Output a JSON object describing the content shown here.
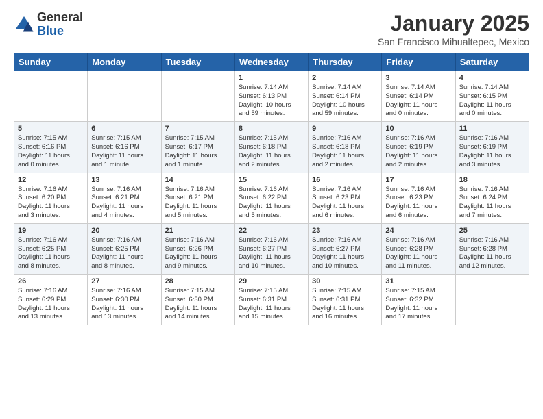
{
  "logo": {
    "general": "General",
    "blue": "Blue"
  },
  "title": "January 2025",
  "subtitle": "San Francisco Mihualtepec, Mexico",
  "days_of_week": [
    "Sunday",
    "Monday",
    "Tuesday",
    "Wednesday",
    "Thursday",
    "Friday",
    "Saturday"
  ],
  "weeks": [
    [
      {
        "num": "",
        "info": ""
      },
      {
        "num": "",
        "info": ""
      },
      {
        "num": "",
        "info": ""
      },
      {
        "num": "1",
        "info": "Sunrise: 7:14 AM\nSunset: 6:13 PM\nDaylight: 10 hours\nand 59 minutes."
      },
      {
        "num": "2",
        "info": "Sunrise: 7:14 AM\nSunset: 6:14 PM\nDaylight: 10 hours\nand 59 minutes."
      },
      {
        "num": "3",
        "info": "Sunrise: 7:14 AM\nSunset: 6:14 PM\nDaylight: 11 hours\nand 0 minutes."
      },
      {
        "num": "4",
        "info": "Sunrise: 7:14 AM\nSunset: 6:15 PM\nDaylight: 11 hours\nand 0 minutes."
      }
    ],
    [
      {
        "num": "5",
        "info": "Sunrise: 7:15 AM\nSunset: 6:16 PM\nDaylight: 11 hours\nand 0 minutes."
      },
      {
        "num": "6",
        "info": "Sunrise: 7:15 AM\nSunset: 6:16 PM\nDaylight: 11 hours\nand 1 minute."
      },
      {
        "num": "7",
        "info": "Sunrise: 7:15 AM\nSunset: 6:17 PM\nDaylight: 11 hours\nand 1 minute."
      },
      {
        "num": "8",
        "info": "Sunrise: 7:15 AM\nSunset: 6:18 PM\nDaylight: 11 hours\nand 2 minutes."
      },
      {
        "num": "9",
        "info": "Sunrise: 7:16 AM\nSunset: 6:18 PM\nDaylight: 11 hours\nand 2 minutes."
      },
      {
        "num": "10",
        "info": "Sunrise: 7:16 AM\nSunset: 6:19 PM\nDaylight: 11 hours\nand 2 minutes."
      },
      {
        "num": "11",
        "info": "Sunrise: 7:16 AM\nSunset: 6:19 PM\nDaylight: 11 hours\nand 3 minutes."
      }
    ],
    [
      {
        "num": "12",
        "info": "Sunrise: 7:16 AM\nSunset: 6:20 PM\nDaylight: 11 hours\nand 3 minutes."
      },
      {
        "num": "13",
        "info": "Sunrise: 7:16 AM\nSunset: 6:21 PM\nDaylight: 11 hours\nand 4 minutes."
      },
      {
        "num": "14",
        "info": "Sunrise: 7:16 AM\nSunset: 6:21 PM\nDaylight: 11 hours\nand 5 minutes."
      },
      {
        "num": "15",
        "info": "Sunrise: 7:16 AM\nSunset: 6:22 PM\nDaylight: 11 hours\nand 5 minutes."
      },
      {
        "num": "16",
        "info": "Sunrise: 7:16 AM\nSunset: 6:23 PM\nDaylight: 11 hours\nand 6 minutes."
      },
      {
        "num": "17",
        "info": "Sunrise: 7:16 AM\nSunset: 6:23 PM\nDaylight: 11 hours\nand 6 minutes."
      },
      {
        "num": "18",
        "info": "Sunrise: 7:16 AM\nSunset: 6:24 PM\nDaylight: 11 hours\nand 7 minutes."
      }
    ],
    [
      {
        "num": "19",
        "info": "Sunrise: 7:16 AM\nSunset: 6:25 PM\nDaylight: 11 hours\nand 8 minutes."
      },
      {
        "num": "20",
        "info": "Sunrise: 7:16 AM\nSunset: 6:25 PM\nDaylight: 11 hours\nand 8 minutes."
      },
      {
        "num": "21",
        "info": "Sunrise: 7:16 AM\nSunset: 6:26 PM\nDaylight: 11 hours\nand 9 minutes."
      },
      {
        "num": "22",
        "info": "Sunrise: 7:16 AM\nSunset: 6:27 PM\nDaylight: 11 hours\nand 10 minutes."
      },
      {
        "num": "23",
        "info": "Sunrise: 7:16 AM\nSunset: 6:27 PM\nDaylight: 11 hours\nand 10 minutes."
      },
      {
        "num": "24",
        "info": "Sunrise: 7:16 AM\nSunset: 6:28 PM\nDaylight: 11 hours\nand 11 minutes."
      },
      {
        "num": "25",
        "info": "Sunrise: 7:16 AM\nSunset: 6:28 PM\nDaylight: 11 hours\nand 12 minutes."
      }
    ],
    [
      {
        "num": "26",
        "info": "Sunrise: 7:16 AM\nSunset: 6:29 PM\nDaylight: 11 hours\nand 13 minutes."
      },
      {
        "num": "27",
        "info": "Sunrise: 7:16 AM\nSunset: 6:30 PM\nDaylight: 11 hours\nand 13 minutes."
      },
      {
        "num": "28",
        "info": "Sunrise: 7:15 AM\nSunset: 6:30 PM\nDaylight: 11 hours\nand 14 minutes."
      },
      {
        "num": "29",
        "info": "Sunrise: 7:15 AM\nSunset: 6:31 PM\nDaylight: 11 hours\nand 15 minutes."
      },
      {
        "num": "30",
        "info": "Sunrise: 7:15 AM\nSunset: 6:31 PM\nDaylight: 11 hours\nand 16 minutes."
      },
      {
        "num": "31",
        "info": "Sunrise: 7:15 AM\nSunset: 6:32 PM\nDaylight: 11 hours\nand 17 minutes."
      },
      {
        "num": "",
        "info": ""
      }
    ]
  ]
}
